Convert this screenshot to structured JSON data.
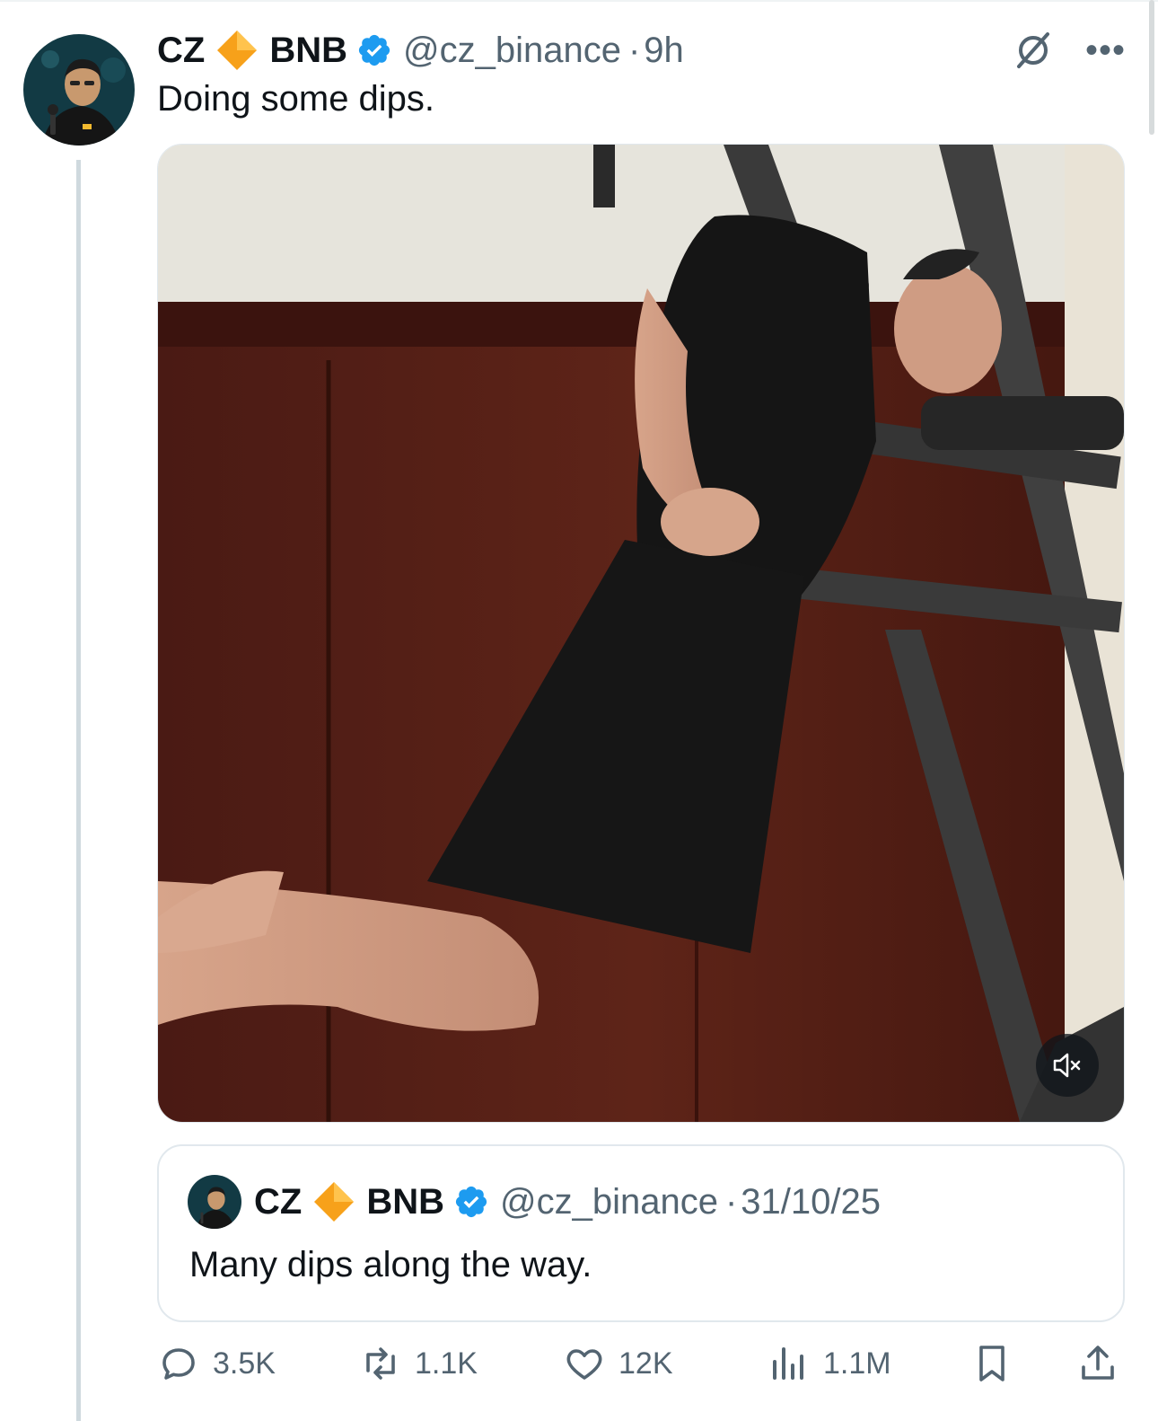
{
  "tweet": {
    "author_name": "CZ",
    "badge_icon": "bnb-diamond-icon",
    "author_name_suffix": "BNB",
    "verified_icon": "verified-badge-icon",
    "handle": "@cz_binance",
    "separator": "·",
    "time": "9h",
    "text": "Doing some dips."
  },
  "media": {
    "type": "video",
    "mute_icon": "speaker-muted-icon"
  },
  "quoted_tweet": {
    "author_name": "CZ",
    "author_name_suffix": "BNB",
    "handle": "@cz_binance",
    "separator": "·",
    "date": "31/10/25",
    "text": "Many dips along the way."
  },
  "actions": {
    "replies": "3.5K",
    "reposts": "1.1K",
    "likes": "12K",
    "views": "1.1M"
  },
  "colors": {
    "text": "#0f1419",
    "secondary": "#536471",
    "verified": "#1d9bf0",
    "bnb": "#f3ba2f",
    "border": "#e1e8ed"
  }
}
